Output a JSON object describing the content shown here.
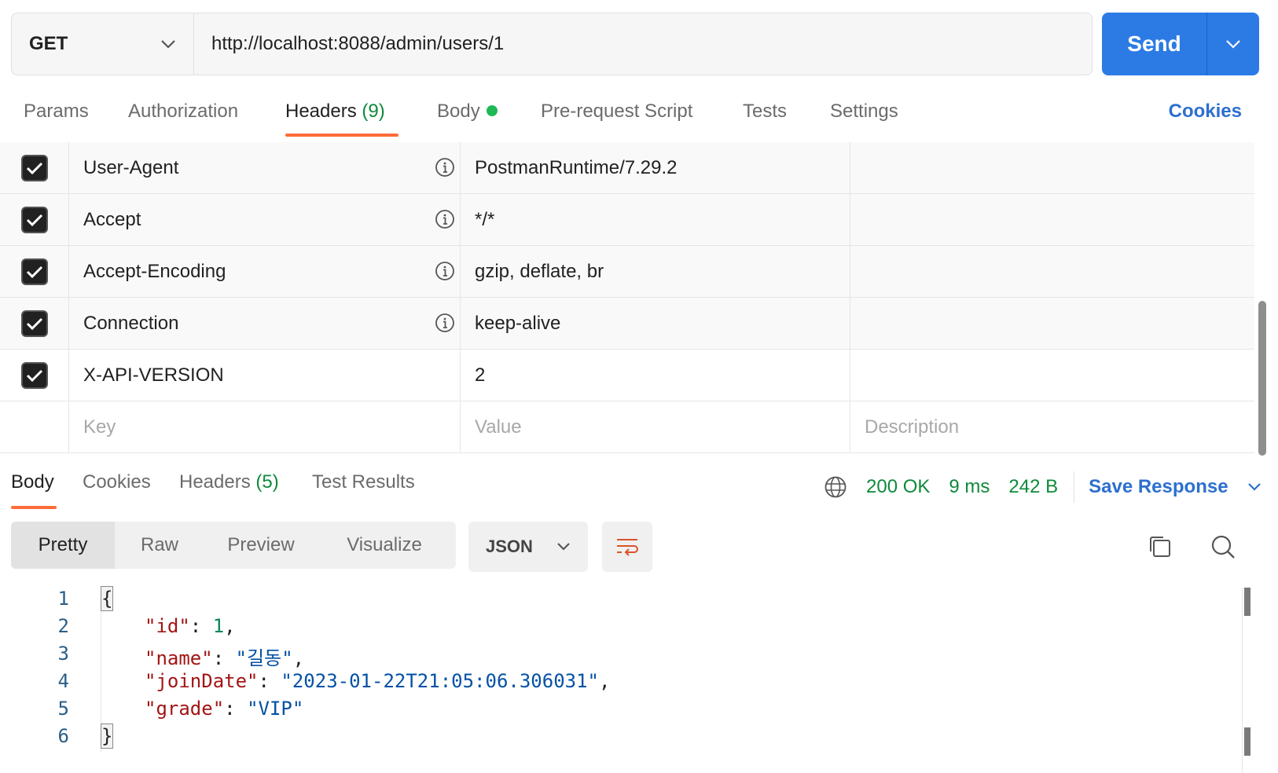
{
  "request": {
    "method": "GET",
    "url": "http://localhost:8088/admin/users/1",
    "send_label": "Send"
  },
  "request_tabs": {
    "params": "Params",
    "authorization": "Authorization",
    "headers": "Headers",
    "headers_count": "(9)",
    "body": "Body",
    "prerequest": "Pre-request Script",
    "tests": "Tests",
    "settings": "Settings",
    "cookies": "Cookies"
  },
  "headers_table": {
    "rows": [
      {
        "key": "User-Agent",
        "value": "PostmanRuntime/7.29.2",
        "checked": true,
        "info": true
      },
      {
        "key": "Accept",
        "value": "*/*",
        "checked": true,
        "info": true
      },
      {
        "key": "Accept-Encoding",
        "value": "gzip, deflate, br",
        "checked": true,
        "info": true
      },
      {
        "key": "Connection",
        "value": "keep-alive",
        "checked": true,
        "info": true
      },
      {
        "key": "X-API-VERSION",
        "value": "2",
        "checked": true,
        "info": false
      }
    ],
    "placeholders": {
      "key": "Key",
      "value": "Value",
      "description": "Description"
    }
  },
  "response_tabs": {
    "body": "Body",
    "cookies": "Cookies",
    "headers": "Headers",
    "headers_count": "(5)",
    "test_results": "Test Results"
  },
  "response_status": {
    "status": "200 OK",
    "time": "9 ms",
    "size": "242 B",
    "save_label": "Save Response"
  },
  "response_view": {
    "modes": [
      "Pretty",
      "Raw",
      "Preview",
      "Visualize"
    ],
    "active_mode": "Pretty",
    "format": "JSON"
  },
  "response_body": {
    "line_numbers": [
      "1",
      "2",
      "3",
      "4",
      "5",
      "6"
    ],
    "open_brace": "{",
    "close_brace": "}",
    "fields": [
      {
        "key": "\"id\"",
        "value": "1",
        "type": "number"
      },
      {
        "key": "\"name\"",
        "value": "\"길동\"",
        "type": "string"
      },
      {
        "key": "\"joinDate\"",
        "value": "\"2023-01-22T21:05:06.306031\"",
        "type": "string"
      },
      {
        "key": "\"grade\"",
        "value": "\"VIP\"",
        "type": "string"
      }
    ]
  },
  "icons": {
    "method_dropdown": "chevron-down-icon",
    "send_dropdown": "chevron-down-icon",
    "info": "info-icon",
    "check": "check-icon",
    "globe": "globe-icon",
    "wrap": "wrap-lines-icon",
    "copy": "copy-icon",
    "search": "search-icon"
  },
  "colors": {
    "accent_orange": "#ff6c37",
    "send_blue": "#2c7be5",
    "status_green": "#0f8a3a",
    "link_blue": "#2c6fcf"
  }
}
